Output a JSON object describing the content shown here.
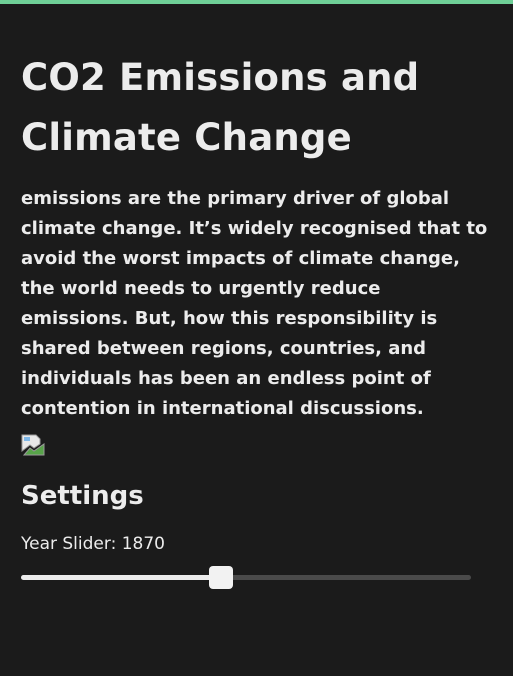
{
  "header": {
    "title": "CO2 Emissions and Climate Change"
  },
  "intro": {
    "text": "emissions are the primary driver of global climate change. It’s widely recognised that to avoid the worst impacts of climate change, the world needs to urgently reduce emissions. But, how this responsibility is shared between regions, countries, and individuals has been an endless point of contention in international discussions."
  },
  "image": {
    "icon": "broken-image-icon"
  },
  "settings": {
    "title": "Settings",
    "year_slider": {
      "label": "Year Slider: ",
      "value": "1870",
      "fraction": 0.444
    }
  },
  "colors": {
    "background": "#1b1b1b",
    "accent": "#6fcf97",
    "text": "#ececec",
    "track": "#4a4a4a"
  }
}
